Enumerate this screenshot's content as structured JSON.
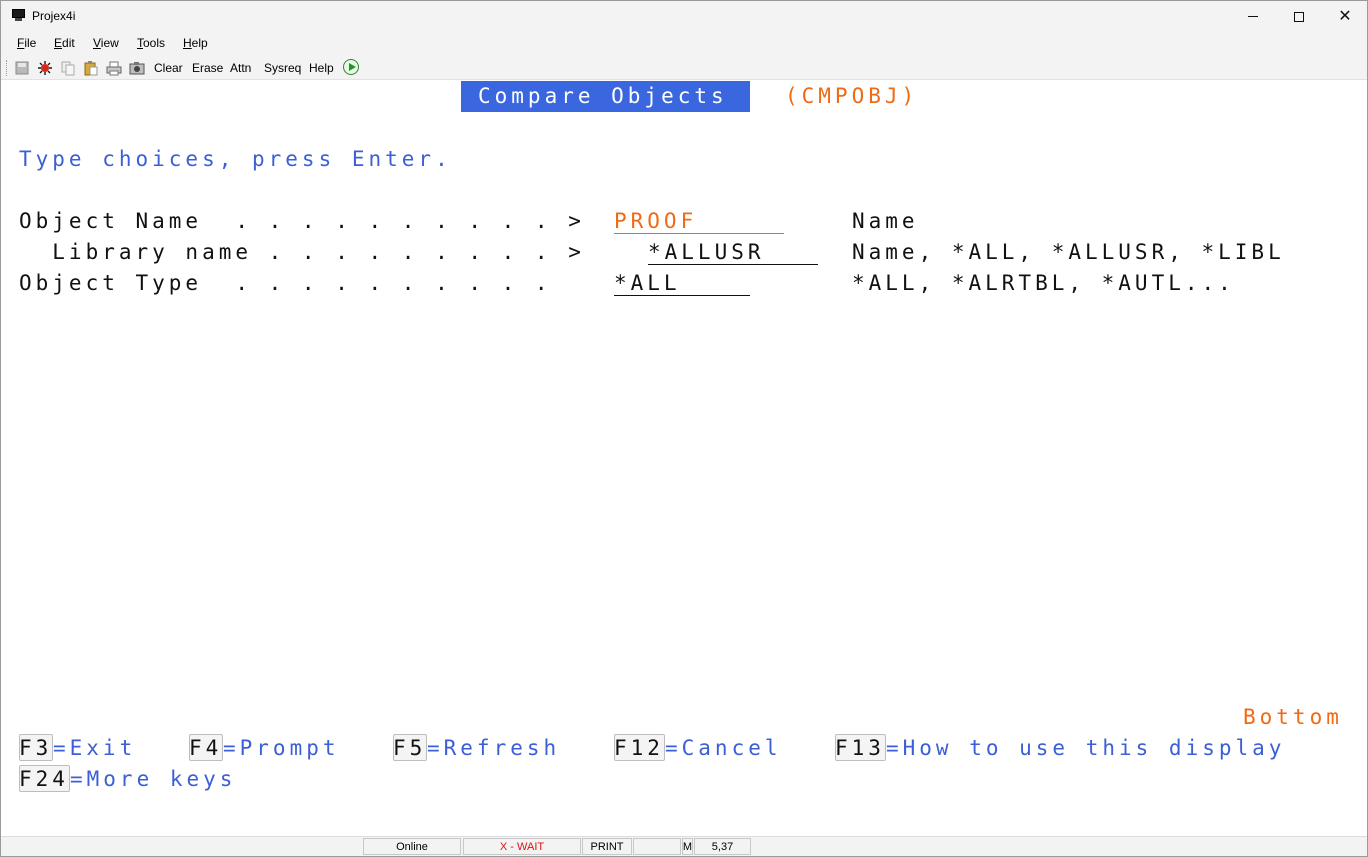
{
  "window": {
    "title": "Projex4i"
  },
  "menu": [
    "File",
    "Edit",
    "View",
    "Tools",
    "Help"
  ],
  "toolbar": {
    "icons": [
      "save-icon",
      "sun-icon",
      "copy-icon",
      "paste-icon",
      "print-icon",
      "camera-icon"
    ],
    "buttons": [
      "Clear",
      "Erase",
      "Attn",
      "Sysreq",
      "Help"
    ],
    "run_icon": "play-icon"
  },
  "screen": {
    "title": "Compare Objects",
    "command": "(CMPOBJ)",
    "instruction": "Type choices, press Enter.",
    "fields": [
      {
        "label": "Object Name  . . . . . . . . . . >",
        "value": "PROOF",
        "help": "Name"
      },
      {
        "label": "  Library name . . . . . . . . . >",
        "value": "*ALLUSR",
        "help": "Name, *ALL, *ALLUSR, *LIBL"
      },
      {
        "label": "Object Type  . . . . . . . . . .",
        "value": "*ALL",
        "help": "*ALL, *ALRTBL, *AUTL..."
      }
    ],
    "more_indicator": "Bottom",
    "function_keys": [
      {
        "key": "F3",
        "text": "=Exit"
      },
      {
        "key": "F4",
        "text": "=Prompt"
      },
      {
        "key": "F5",
        "text": "=Refresh"
      },
      {
        "key": "F12",
        "text": "=Cancel"
      },
      {
        "key": "F13",
        "text": "=How to use this display"
      },
      {
        "key": "F24",
        "text": "=More keys"
      }
    ]
  },
  "status": {
    "connection": "Online",
    "wait": "X - WAIT",
    "print": "PRINT",
    "empty": "",
    "mode": "M",
    "cursor": "5,37"
  }
}
